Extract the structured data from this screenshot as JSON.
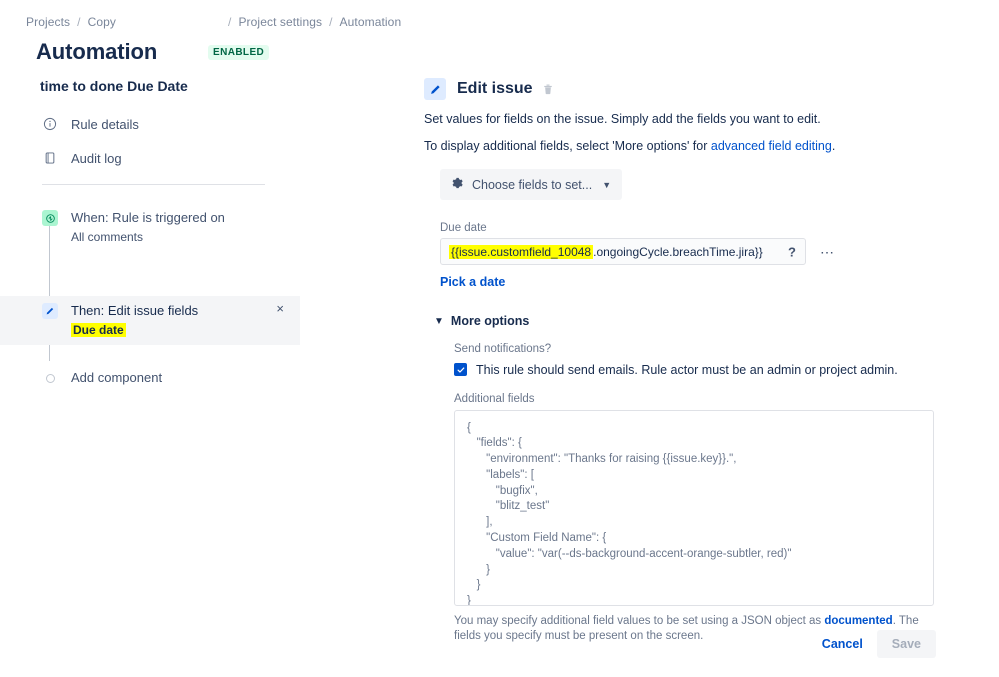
{
  "breadcrumb": {
    "items": [
      "Projects",
      "Copy",
      "Project settings",
      "Automation"
    ],
    "separator": "/"
  },
  "header": {
    "title": "Automation",
    "status_badge": "ENABLED",
    "badge_bg": "#E3FCEF",
    "badge_color": "#006644"
  },
  "rule_panel": {
    "rule_name": "time to done Due Date",
    "nav": [
      {
        "label": "Rule details",
        "icon": "info-circle-icon"
      },
      {
        "label": "Audit log",
        "icon": "audit-log-icon"
      }
    ],
    "tree": [
      {
        "title": "When: Rule is triggered on",
        "subtitle": "All comments",
        "icon": "trigger-icon",
        "selected": false
      },
      {
        "title": "Then: Edit issue fields",
        "subtitle": "Due date",
        "subtitle_highlighted": true,
        "icon": "edit-pencil-icon",
        "selected": true,
        "close_label": "×"
      },
      {
        "title": "Add component",
        "icon": "add-circle-icon",
        "selected": false
      }
    ],
    "highlight_color": "#FFFF00"
  },
  "detail": {
    "title": "Edit issue",
    "icon": "edit-pencil-icon",
    "delete_icon": "trash-icon",
    "description_1": "Set values for fields on the issue. Simply add the fields you want to edit.",
    "description_2_before": "To display additional fields, select 'More options' for ",
    "description_2_link": "advanced field editing",
    "description_2_after": ".",
    "choose_fields_label": "Choose fields to set...",
    "choose_fields_icon": "gear-icon",
    "due_date": {
      "label": "Due date",
      "value_highlighted": "{{issue.customfield_10048",
      "value_rest": ".ongoingCycle.breachTime.jira}}",
      "help_icon": "question-mark-icon",
      "more_icon": "ellipsis-icon",
      "pick_a_date_label": "Pick a date"
    },
    "more_options": {
      "label": "More options",
      "caret": "⌄",
      "send_notifications_label": "Send notifications?",
      "checkbox_checked": true,
      "checkbox_label": "This rule should send emails. Rule actor must be an admin or project admin.",
      "additional_fields_label": "Additional fields",
      "additional_fields_json": "{\n   \"fields\": {\n      \"environment\": \"Thanks for raising {{issue.key}}.\",\n      \"labels\": [\n         \"bugfix\",\n         \"blitz_test\"\n      ],\n      \"Custom Field Name\": {\n         \"value\": \"var(--ds-background-accent-orange-subtler, red)\"\n      }\n   }\n}",
      "help_before": "You may specify additional field values to be set using a JSON object as ",
      "help_link": "documented",
      "help_after": ". The fields you specify must be present on the screen."
    }
  },
  "footer": {
    "cancel_label": "Cancel",
    "save_label": "Save",
    "save_disabled": true
  }
}
